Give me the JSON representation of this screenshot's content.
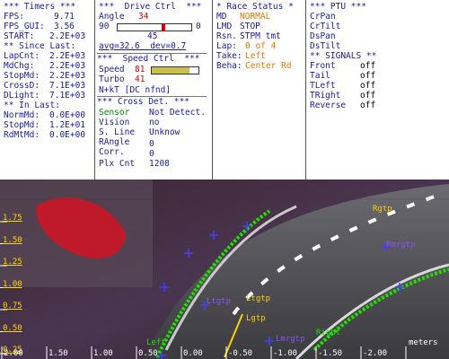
{
  "timers": {
    "title": "*** Timers ***",
    "fps_label": "FPS:",
    "fps": "9.71",
    "fps_gui_label": "FPS_GUI:",
    "fps_gui": "3.56",
    "start_label": "START:",
    "start": "2.2E+03",
    "since_title": "** Since Last:",
    "since": [
      {
        "label": "LapCnt:",
        "value": "2.2E+03"
      },
      {
        "label": "MdChg:",
        "value": "2.2E+03"
      },
      {
        "label": "StopMd:",
        "value": "2.2E+03"
      },
      {
        "label": "CrossD:",
        "value": "7.1E+03"
      },
      {
        "label": "DLight:",
        "value": "7.1E+03"
      }
    ],
    "inlast_title": "** In Last:",
    "inlast": [
      {
        "label": "NormMd:",
        "value": "0.0E+00"
      },
      {
        "label": "StopMd:",
        "value": "1.2E+01"
      },
      {
        "label": "RdMtMd:",
        "value": "0.0E+00"
      }
    ]
  },
  "drive": {
    "title": "***  Drive Ctrl  ***",
    "angle_label": "Angle",
    "angle": "34",
    "range_min": "90",
    "range_max": "0",
    "mid": "45",
    "angle_fraction": 0.62,
    "avg": "avg=32.6  dev=0.7",
    "speed_title": "***  Speed Ctrl  ***",
    "speed_label": "Speed",
    "speed": "81",
    "speed_fraction": 0.81,
    "turbo_label": "Turbo",
    "turbo": "41",
    "nkt": "N+kT [DC nfnd]",
    "cross_title": "*** Cross Det. ***",
    "cross": [
      {
        "label": "Sensor",
        "value": "Not Detect."
      },
      {
        "label": "Vision",
        "value": "no"
      },
      {
        "label": "S. Line",
        "value": "Unknow"
      },
      {
        "label": "RAngle",
        "value": "0"
      },
      {
        "label": "Corr.",
        "value": "0"
      },
      {
        "label": "Plx Cnt",
        "value": "1208"
      }
    ]
  },
  "race": {
    "title": "* Race Status *",
    "rows": [
      {
        "label": "MD",
        "value": "NORMAL"
      },
      {
        "label": "LMD",
        "value": "STOP"
      },
      {
        "label": "Rsn.",
        "value": "STPM tmt"
      },
      {
        "label": "Lap:",
        "value": "0 of 4"
      },
      {
        "label": "Take:",
        "value": "Left"
      },
      {
        "label": "Beha:",
        "value": "Center Rd"
      }
    ]
  },
  "ptu": {
    "title": "*** PTU ***",
    "items": [
      "CrPan",
      "CrTilt",
      "DsPan",
      "DsTilt"
    ],
    "signals_title": "** SIGNALS **",
    "signals": [
      {
        "label": "Front",
        "value": "off"
      },
      {
        "label": "Tail",
        "value": "off"
      },
      {
        "label": "TLeft",
        "value": "off"
      },
      {
        "label": "TRight",
        "value": "off"
      },
      {
        "label": "Reverse",
        "value": "off"
      }
    ]
  },
  "camera": {
    "y_ticks": [
      "1.75",
      "1.50",
      "1.25",
      "1.00",
      "0.75",
      "0.50",
      "0.25",
      "0.00"
    ],
    "x_ticks": [
      "2.00",
      "1.50",
      "1.00",
      "0.50",
      "0.00",
      "-0.50",
      "-1.00",
      "-1.50",
      "-2.00"
    ],
    "unit": "meters",
    "labels": {
      "rgtp": "Rgtp",
      "ltgtp1": "Ltgtp",
      "ltgtp2": "Lgtp",
      "lmrgtp": "Lmrgtp",
      "left": "Left",
      "right": "Right",
      "rmrgtp": "Rmrgtp",
      "ltgtp3": "Ltgtp"
    },
    "colors": {
      "lane": "#22e000",
      "marker": "#4040ff",
      "axis_text": "#ffd800",
      "target": "#ffd000"
    }
  }
}
